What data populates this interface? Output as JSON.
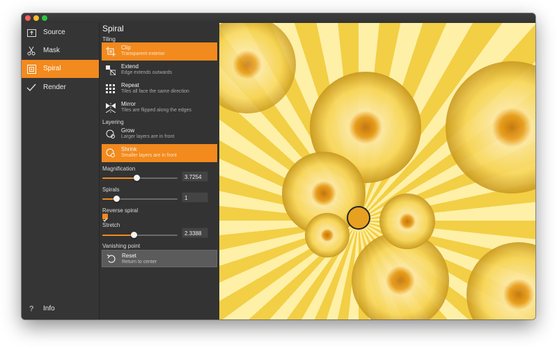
{
  "window": {
    "traffic_lights": [
      "close",
      "minimize",
      "maximize"
    ]
  },
  "sidebar": {
    "items": [
      {
        "label": "Source",
        "icon": "source-icon",
        "active": false
      },
      {
        "label": "Mask",
        "icon": "scissors-icon",
        "active": false
      },
      {
        "label": "Spiral",
        "icon": "spiral-icon",
        "active": true
      },
      {
        "label": "Render",
        "icon": "checkmark-icon",
        "active": false
      }
    ],
    "info": {
      "label": "Info",
      "icon": "question-icon"
    }
  },
  "panel": {
    "title": "Spiral",
    "tiling_label": "Tiling",
    "tiling_options": [
      {
        "name": "Clip",
        "desc": "Transparent exterior",
        "icon": "clip-icon",
        "active": true
      },
      {
        "name": "Extend",
        "desc": "Edge extends outwards",
        "icon": "extend-icon",
        "active": false
      },
      {
        "name": "Repeat",
        "desc": "Tiles all face the same direction",
        "icon": "repeat-icon",
        "active": false
      },
      {
        "name": "Mirror",
        "desc": "Tiles are flipped along the edges",
        "icon": "mirror-icon",
        "active": false
      }
    ],
    "layering_label": "Layering",
    "layering_options": [
      {
        "name": "Grow",
        "desc": "Larger layers are in front",
        "icon": "grow-icon",
        "active": false
      },
      {
        "name": "Shrink",
        "desc": "Smaller layers are in front",
        "icon": "shrink-icon",
        "active": true
      }
    ],
    "magnification": {
      "label": "Magnification",
      "value": "3.7254",
      "slider_fraction": 0.46
    },
    "spirals": {
      "label": "Spirals",
      "value": "1",
      "slider_fraction": 0.19
    },
    "reverse_spiral": {
      "label": "Reverse spiral",
      "checked": true
    },
    "stretch": {
      "label": "Stretch",
      "value": "2.3388",
      "slider_fraction": 0.42
    },
    "vanishing_point": {
      "label": "Vanishing point"
    },
    "reset": {
      "name": "Reset",
      "desc": "Return to center",
      "icon": "reset-icon"
    }
  },
  "colors": {
    "accent": "#f28a1e",
    "sidebar_bg": "#353535",
    "panel_bg": "#333333"
  }
}
